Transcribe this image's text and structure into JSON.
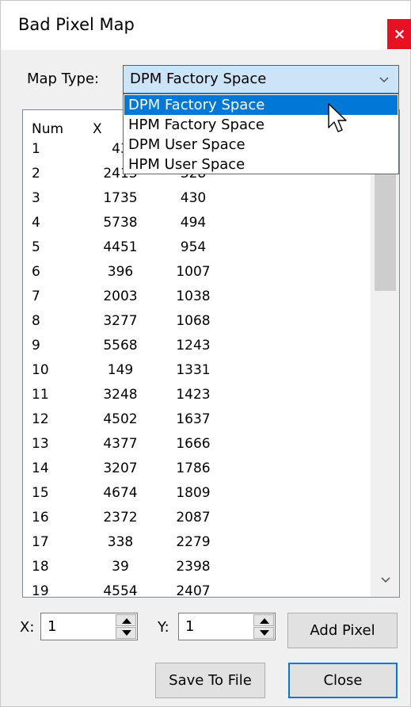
{
  "window": {
    "title": "Bad Pixel Map",
    "close_glyph": "×"
  },
  "map_type": {
    "label": "Map Type:",
    "selected": "DPM Factory Space",
    "options": [
      "DPM Factory Space",
      "HPM Factory Space",
      "DPM User Space",
      "HPM User Space"
    ],
    "highlighted_option": "DPM Factory Space"
  },
  "table": {
    "columns": [
      "Num",
      "X",
      "Y"
    ],
    "rows": [
      [
        "1",
        "43",
        ""
      ],
      [
        "2",
        "2413",
        "328"
      ],
      [
        "3",
        "1735",
        "430"
      ],
      [
        "4",
        "5738",
        "494"
      ],
      [
        "5",
        "4451",
        "954"
      ],
      [
        "6",
        "396",
        "1007"
      ],
      [
        "7",
        "2003",
        "1038"
      ],
      [
        "8",
        "3277",
        "1068"
      ],
      [
        "9",
        "5568",
        "1243"
      ],
      [
        "10",
        "149",
        "1331"
      ],
      [
        "11",
        "3248",
        "1423"
      ],
      [
        "12",
        "4502",
        "1637"
      ],
      [
        "13",
        "4377",
        "1666"
      ],
      [
        "14",
        "3207",
        "1786"
      ],
      [
        "15",
        "4674",
        "1809"
      ],
      [
        "16",
        "2372",
        "2087"
      ],
      [
        "17",
        "338",
        "2279"
      ],
      [
        "18",
        "39",
        "2398"
      ],
      [
        "19",
        "4554",
        "2407"
      ]
    ]
  },
  "inputs": {
    "x_label": "X:",
    "x_value": "1",
    "y_label": "Y:",
    "y_value": "1"
  },
  "buttons": {
    "add_pixel": "Add Pixel",
    "save_to_file": "Save To File",
    "close": "Close"
  },
  "colors": {
    "accent": "#0078d7",
    "close_red": "#e81123",
    "combo_bg": "#cce4f7"
  }
}
